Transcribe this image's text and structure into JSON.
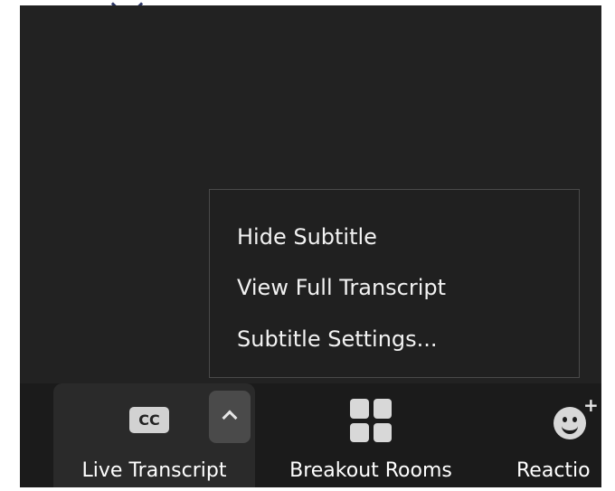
{
  "menu": {
    "items": [
      {
        "label": "Hide Subtitle"
      },
      {
        "label": "View Full Transcript"
      },
      {
        "label": "Subtitle Settings..."
      }
    ]
  },
  "toolbar": {
    "live_transcript": {
      "label": "Live Transcript",
      "icon_text": "CC",
      "icon": "closed-caption-icon"
    },
    "breakout_rooms": {
      "label": "Breakout Rooms",
      "icon": "grid-icon"
    },
    "reactions": {
      "label": "Reactio",
      "icon": "emoji-plus-icon"
    }
  },
  "colors": {
    "background": "#222222",
    "toolbar": "#1b1b1b",
    "menu": "#202020",
    "text": "#f2f2f2"
  }
}
